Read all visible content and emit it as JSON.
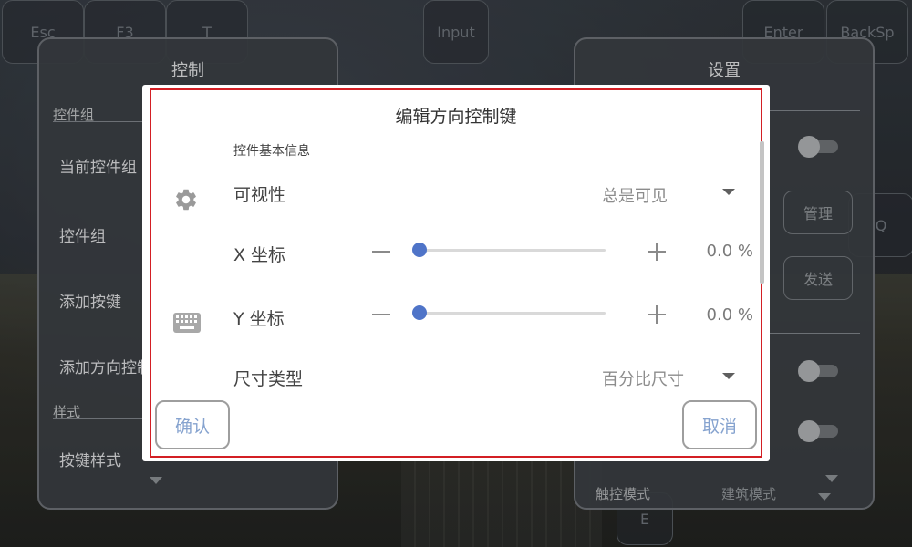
{
  "background_keys": {
    "esc": "Esc",
    "f3": "F3",
    "t": "T",
    "input": "Input",
    "enter": "Enter",
    "backsp": "BackSp",
    "q": "Q",
    "e": "E"
  },
  "left_panel": {
    "title": "控制",
    "section_widgets": "控件组",
    "items": [
      "当前控件组",
      "控件组",
      "添加按键",
      "添加方向控制"
    ],
    "section_style": "样式",
    "style_item": "按键样式"
  },
  "right_panel": {
    "title": "设置",
    "manage_button": "管理",
    "send_button": "发送",
    "bottom_label": "触控模式",
    "bottom_value": "建筑模式"
  },
  "dialog": {
    "title": "编辑方向控制键",
    "section": "控件基本信息",
    "visibility": {
      "label": "可视性",
      "value": "总是可见"
    },
    "x_coord": {
      "label": "X 坐标",
      "value": "0.0 %",
      "fraction": 0.0
    },
    "y_coord": {
      "label": "Y 坐标",
      "value": "0.0 %",
      "fraction": 0.0
    },
    "size_type": {
      "label": "尺寸类型",
      "value": "百分比尺寸"
    },
    "confirm": "确认",
    "cancel": "取消",
    "icons": {
      "gear": "gear-icon",
      "keyboard": "keyboard-icon"
    },
    "accent": "#4f74c8",
    "frame_color": "#d31f24"
  }
}
